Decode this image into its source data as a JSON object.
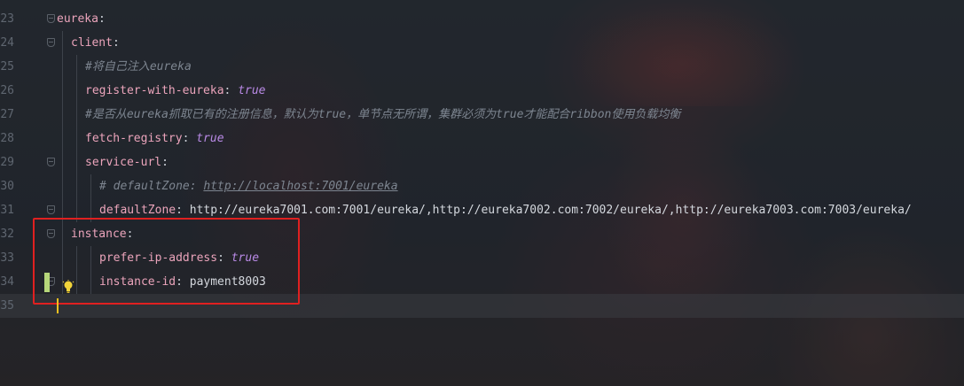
{
  "lines": [
    {
      "num": "23",
      "indent": 0,
      "parts": [
        {
          "t": "eureka",
          "c": "key"
        },
        {
          "t": ":",
          "c": "punc"
        }
      ]
    },
    {
      "num": "24",
      "indent": 1,
      "parts": [
        {
          "t": "client",
          "c": "key"
        },
        {
          "t": ":",
          "c": "punc"
        }
      ]
    },
    {
      "num": "25",
      "indent": 2,
      "parts": [
        {
          "t": "#将自己注入eureka",
          "c": "cmt"
        }
      ]
    },
    {
      "num": "26",
      "indent": 2,
      "parts": [
        {
          "t": "register-with-eureka",
          "c": "key"
        },
        {
          "t": ": ",
          "c": "punc"
        },
        {
          "t": "true",
          "c": "bool"
        }
      ]
    },
    {
      "num": "27",
      "indent": 2,
      "parts": [
        {
          "t": "#是否从eureka抓取已有的注册信息，默认为true，单节点无所谓，集群必须为true才能配合ribbon使用负载均衡",
          "c": "cmt"
        }
      ]
    },
    {
      "num": "28",
      "indent": 2,
      "parts": [
        {
          "t": "fetch-registry",
          "c": "key"
        },
        {
          "t": ": ",
          "c": "punc"
        },
        {
          "t": "true",
          "c": "bool"
        }
      ]
    },
    {
      "num": "29",
      "indent": 2,
      "parts": [
        {
          "t": "service-url",
          "c": "key"
        },
        {
          "t": ":",
          "c": "punc"
        }
      ]
    },
    {
      "num": "30",
      "indent": 3,
      "parts": [
        {
          "t": "# defaultZone: ",
          "c": "cmt"
        },
        {
          "t": "http://localhost:7001/eureka",
          "c": "cmt-url"
        }
      ]
    },
    {
      "num": "31",
      "indent": 3,
      "parts": [
        {
          "t": "defaultZone",
          "c": "key"
        },
        {
          "t": ": ",
          "c": "punc"
        },
        {
          "t": "http://eureka7001.com:7001/eureka/,http://eureka7002.com:7002/eureka/,http://eureka7003.com:7003/eureka/",
          "c": "str"
        }
      ]
    },
    {
      "num": "32",
      "indent": 1,
      "parts": [
        {
          "t": "instance",
          "c": "key"
        },
        {
          "t": ":",
          "c": "punc"
        }
      ]
    },
    {
      "num": "33",
      "indent": 3,
      "parts": [
        {
          "t": "prefer-ip-address",
          "c": "key"
        },
        {
          "t": ": ",
          "c": "punc"
        },
        {
          "t": "true",
          "c": "bool"
        }
      ]
    },
    {
      "num": "34",
      "indent": 3,
      "parts": [
        {
          "t": "instance-id",
          "c": "key"
        },
        {
          "t": ": ",
          "c": "punc"
        },
        {
          "t": "payment8003",
          "c": "str"
        }
      ]
    },
    {
      "num": "35",
      "indent": 0,
      "parts": []
    }
  ],
  "current_line": "35",
  "icons": {
    "fold": "fold-marker-icon",
    "bulb": "lightbulb-icon"
  },
  "colors": {
    "highlight_box": "#e02020",
    "key": "#eba4bb",
    "bool": "#b98ae6",
    "comment": "#7d8590"
  }
}
